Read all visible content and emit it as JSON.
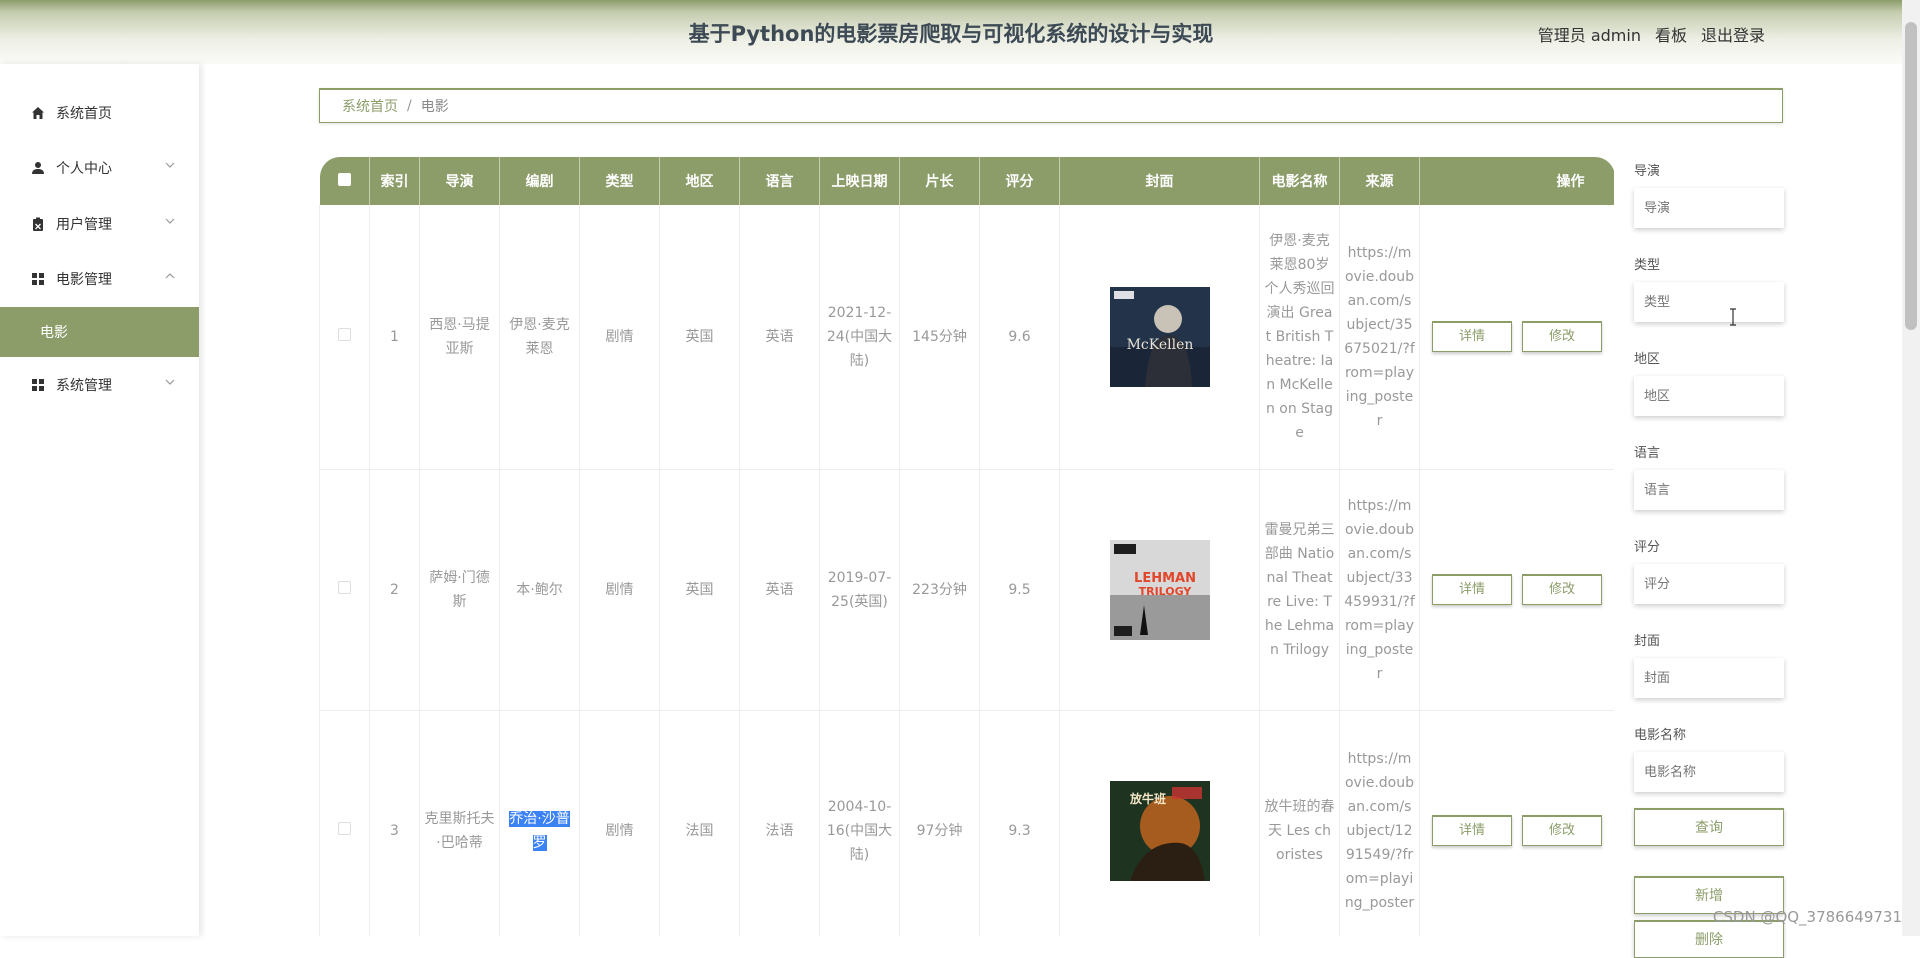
{
  "header": {
    "title": "基于Python的电影票房爬取与可视化系统的设计与实现",
    "role": "管理员 admin",
    "board": "看板",
    "logout": "退出登录"
  },
  "sidebar": {
    "items": [
      {
        "label": "系统首页",
        "icon": "home-icon"
      },
      {
        "label": "个人中心",
        "icon": "user-icon"
      },
      {
        "label": "用户管理",
        "icon": "clipboard-icon"
      },
      {
        "label": "电影管理",
        "icon": "grid-icon"
      },
      {
        "label": "电影",
        "icon": ""
      },
      {
        "label": "系统管理",
        "icon": "grid-icon"
      }
    ]
  },
  "breadcrumb": {
    "home": "系统首页",
    "sep": "/",
    "current": "电影"
  },
  "table": {
    "headers": [
      "",
      "索引",
      "导演",
      "编剧",
      "类型",
      "地区",
      "语言",
      "上映日期",
      "片长",
      "评分",
      "封面",
      "电影名称",
      "来源",
      "操作"
    ],
    "rows": [
      {
        "index": "1",
        "director": "西恩·马提亚斯",
        "writer": "伊恩·麦克莱恩",
        "genre": "剧情",
        "region": "英国",
        "language": "英语",
        "release": "2021-12-24(中国大陆)",
        "runtime": "145分钟",
        "score": "9.6",
        "name": "伊恩·麦克莱恩80岁个人秀巡回演出 Great British Theatre: Ian McKellen on Stage",
        "source": "https://movie.douban.com/subject/35675021/?from=playing_poster"
      },
      {
        "index": "2",
        "director": "萨姆·门德斯",
        "writer": "本·鲍尔",
        "genre": "剧情",
        "region": "英国",
        "language": "英语",
        "release": "2019-07-25(英国)",
        "runtime": "223分钟",
        "score": "9.5",
        "name": "雷曼兄弟三部曲 National Theatre Live: The Lehman Trilogy",
        "source": "https://movie.douban.com/subject/33459931/?from=playing_poster"
      },
      {
        "index": "3",
        "director": "克里斯托夫·巴哈蒂",
        "writer": "乔治·沙普罗",
        "genre": "剧情",
        "region": "法国",
        "language": "法语",
        "release": "2004-10-16(中国大陆)",
        "runtime": "97分钟",
        "score": "9.3",
        "name": "放牛班的春天 Les choristes",
        "source": "https://movie.douban.com/subject/1291549/?from=playing_poster"
      }
    ],
    "detail_label": "详情",
    "edit_label": "修改"
  },
  "search": {
    "fields": [
      {
        "label": "导演",
        "placeholder": "导演"
      },
      {
        "label": "类型",
        "placeholder": "类型"
      },
      {
        "label": "地区",
        "placeholder": "地区"
      },
      {
        "label": "语言",
        "placeholder": "语言"
      },
      {
        "label": "评分",
        "placeholder": "评分"
      },
      {
        "label": "封面",
        "placeholder": "封面"
      },
      {
        "label": "电影名称",
        "placeholder": "电影名称"
      }
    ],
    "query_label": "查询",
    "add_label": "新增",
    "delete_label": "删除"
  },
  "watermark": "CSDN @QQ_3786649731",
  "colors": {
    "accent": "#8c9d6a"
  }
}
